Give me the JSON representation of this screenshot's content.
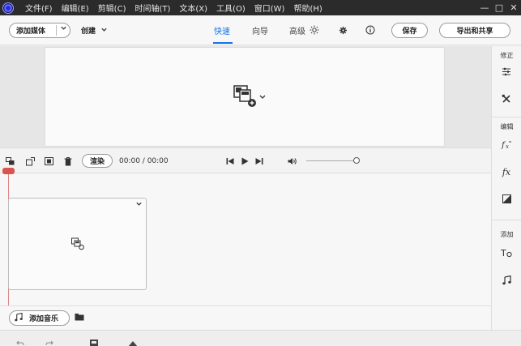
{
  "menubar": {
    "items": [
      "文件(F)",
      "编辑(E)",
      "剪辑(C)",
      "时间轴(T)",
      "文本(X)",
      "工具(O)",
      "窗口(W)",
      "帮助(H)"
    ],
    "controls": [
      "—",
      "□",
      "✕"
    ]
  },
  "toolbar": {
    "add_media_label": "添加媒体",
    "create_label": "创建",
    "tabs": [
      "快速",
      "向导",
      "高级"
    ],
    "active_tab": "快速",
    "save_label": "保存",
    "export_label": "导出和共享"
  },
  "right_panel": {
    "section_fix": "修正",
    "section_edit": "编辑",
    "section_add": "添加",
    "fx_label": "fx"
  },
  "timeline_toolbar": {
    "render_label": "渲染",
    "timecode": "00:00 / 00:00"
  },
  "audio": {
    "add_music_label": "添加音乐"
  },
  "colors": {
    "accent": "#1473e6",
    "menubar_bg": "#2b2b2b",
    "playhead": "#d9534f"
  }
}
